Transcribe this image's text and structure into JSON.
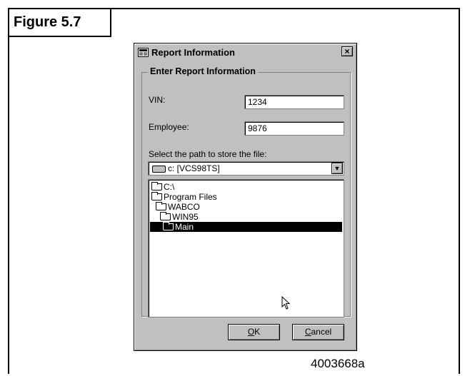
{
  "figure": {
    "label": "Figure 5.7",
    "code": "4003668a"
  },
  "dialog": {
    "title": "Report Information",
    "close_label": "×",
    "group_title": "Enter Report Information",
    "vin": {
      "label": "VIN:",
      "value": "1234"
    },
    "employee": {
      "label": "Employee:",
      "value": "9876"
    },
    "path_label": "Select the path to store the file:",
    "drive": {
      "value": "c: [VCS98TS]"
    },
    "tree": [
      {
        "label": "C:\\",
        "selected": false
      },
      {
        "label": "Program Files",
        "selected": false
      },
      {
        "label": "WABCO",
        "selected": false
      },
      {
        "label": "WIN95",
        "selected": false
      },
      {
        "label": "Main",
        "selected": true
      }
    ],
    "ok_label": {
      "mnemonic": "O",
      "rest": "K"
    },
    "cancel_label": {
      "mnemonic": "C",
      "rest": "ancel"
    }
  },
  "icons": [
    "window-app-icon",
    "close-icon",
    "drive-icon",
    "dropdown-arrow-icon",
    "folder-icon",
    "mouse-pointer-icon"
  ]
}
